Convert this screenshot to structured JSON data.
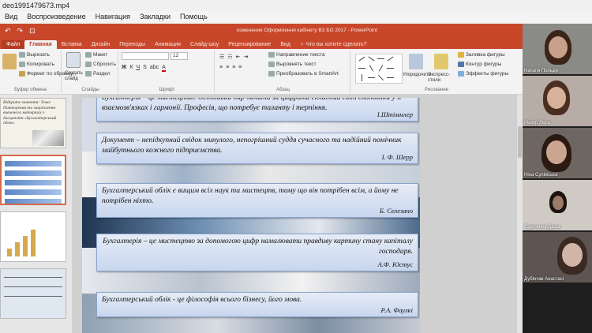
{
  "player": {
    "title": "deo1991479673.mp4",
    "menu": [
      "Вид",
      "Воспроизведение",
      "Навигация",
      "Закладки",
      "Помощь"
    ]
  },
  "ppt": {
    "quick_access": [
      "↶",
      "↷",
      "⊡"
    ],
    "doc_title": "изменение Оформлення кабінету ВЗ БО 2017  -  PowerPoint",
    "tabs": [
      "Файл",
      "Главная",
      "Вставка",
      "Дизайн",
      "Переходы",
      "Анимация",
      "Слайд-шоу",
      "Рецензирование",
      "Вид"
    ],
    "active_tab": "Главная",
    "tell_me": "♀ Что вы хотите сделать?",
    "ribbon": {
      "clipboard": {
        "cut": "Вырезать",
        "copy": "Копировать",
        "format": "Формат по образцу",
        "label": "Буфер обмена"
      },
      "slides": {
        "new": "Создать слайд",
        "layout": "Макет",
        "reset": "Сбросить",
        "section": "Раздел",
        "label": "Слайды"
      },
      "font": {
        "label": "Шрифт",
        "size": "12"
      },
      "paragraph": {
        "direction": "Направление текста",
        "align": "Выровнять текст",
        "smartart": "Преобразовать в SmartArt",
        "label": "Абзац"
      },
      "drawing": {
        "arrange": "Упорядочить",
        "styles": "Экспресс-стили",
        "fill": "Заливка фигуры",
        "outline": "Контур фигуры",
        "effects": "Эффекты фигуры",
        "label": "Рисование"
      }
    }
  },
  "thumbnails": {
    "numbers": [
      "",
      "",
      "",
      ""
    ],
    "slide1_text": "Відкрите заняття: Тема: Повторення та закріплення вивченого матеріалу з дисципліни «Бухгалтерський облік»"
  },
  "slide": {
    "quotes": [
      {
        "text": "Бухгалтерія – це мистецтво. Особливий дар бачити за цифрами складний світ економіки у її взаємозв'язках і гармонії. Професія, що потребує таланту і терпіння.",
        "author": "І.Штіммлер"
      },
      {
        "text": "Документ – непідкупний свідок минулого, непогрішний суддя сучасного та надійний помічник майбутнього кожного підприємства.",
        "author": "І. Ф. Шерр"
      },
      {
        "text": "Бухгалтерський облік є вищим всіх наук та мистецтв, тому що він потрібен всім, а йому не потрібен ніхто.",
        "author": "Б. Селезано"
      },
      {
        "text": "Бухгалтерія – це мистецтво за допомогою цифр намалювати правдиву картину стану капіталу господаря.",
        "author": "А.Ф. Юстус"
      },
      {
        "text": "Бухгалтерський облік -  це філософія всього бізнесу,  його мова.",
        "author": "Р.А. Фаулкі"
      }
    ]
  },
  "participants": [
    {
      "name": "Наталя Польде",
      "skin": "#c9a089",
      "bg": "#8a8a86",
      "hair": "#3a2418"
    },
    {
      "name": "Мазур Лера",
      "skin": "#d7b19a",
      "bg": "#b7aca6",
      "hair": "#4a2e20"
    },
    {
      "name": "Ніна Сулімська",
      "skin": "#caa58f",
      "bg": "#6d6661",
      "hair": "#2a1a12"
    },
    {
      "name": "Сідельник Даша",
      "skin": "#9c7a68",
      "bg": "#cfcac4",
      "hair": "#1d1410"
    },
    {
      "name": "Дубінчак Анастасі",
      "skin": "#d1b6a8",
      "bg": "#5e5552",
      "hair": "#3b2a22"
    }
  ]
}
